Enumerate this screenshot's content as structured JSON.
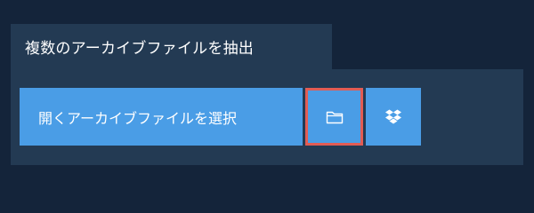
{
  "section": {
    "title": "複数のアーカイブファイルを抽出"
  },
  "toolbar": {
    "open_label": "開くアーカイブファイルを選択",
    "folder_icon": "folder-icon",
    "dropbox_icon": "dropbox-icon"
  },
  "colors": {
    "page_background": "#14243a",
    "panel_background": "#233a53",
    "button_background": "#4a9de6",
    "highlight_border": "#e25c54",
    "text": "#ffffff"
  }
}
